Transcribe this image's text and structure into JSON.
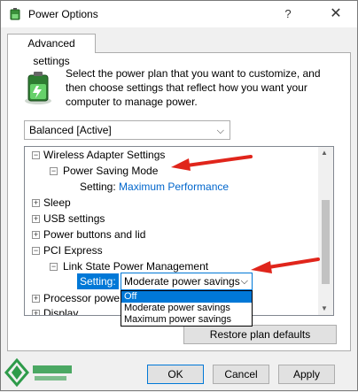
{
  "window": {
    "title": "Power Options",
    "help_glyph": "?",
    "close_glyph": "✕"
  },
  "tab": {
    "label": "Advanced settings"
  },
  "intro": {
    "text": "Select the power plan that you want to customize, and then choose settings that reflect how you want your computer to manage power."
  },
  "plan": {
    "selected": "Balanced [Active]"
  },
  "tree": {
    "wireless": "Wireless Adapter Settings",
    "power_saving_mode": "Power Saving Mode",
    "psm_setting_label": "Setting:",
    "psm_setting_value": "Maximum Performance",
    "sleep": "Sleep",
    "usb": "USB settings",
    "power_buttons": "Power buttons and lid",
    "pci": "PCI Express",
    "lspm": "Link State Power Management",
    "lspm_setting_label": "Setting:",
    "processor": "Processor powe",
    "display": "Display"
  },
  "combo": {
    "selected": "Moderate power savings",
    "options": [
      "Off",
      "Moderate power savings",
      "Maximum power savings"
    ]
  },
  "buttons": {
    "restore": "Restore plan defaults",
    "ok": "OK",
    "cancel": "Cancel",
    "apply": "Apply"
  },
  "colors": {
    "accent": "#0078d7",
    "link": "#0066cc",
    "arrow": "#e0251b"
  }
}
